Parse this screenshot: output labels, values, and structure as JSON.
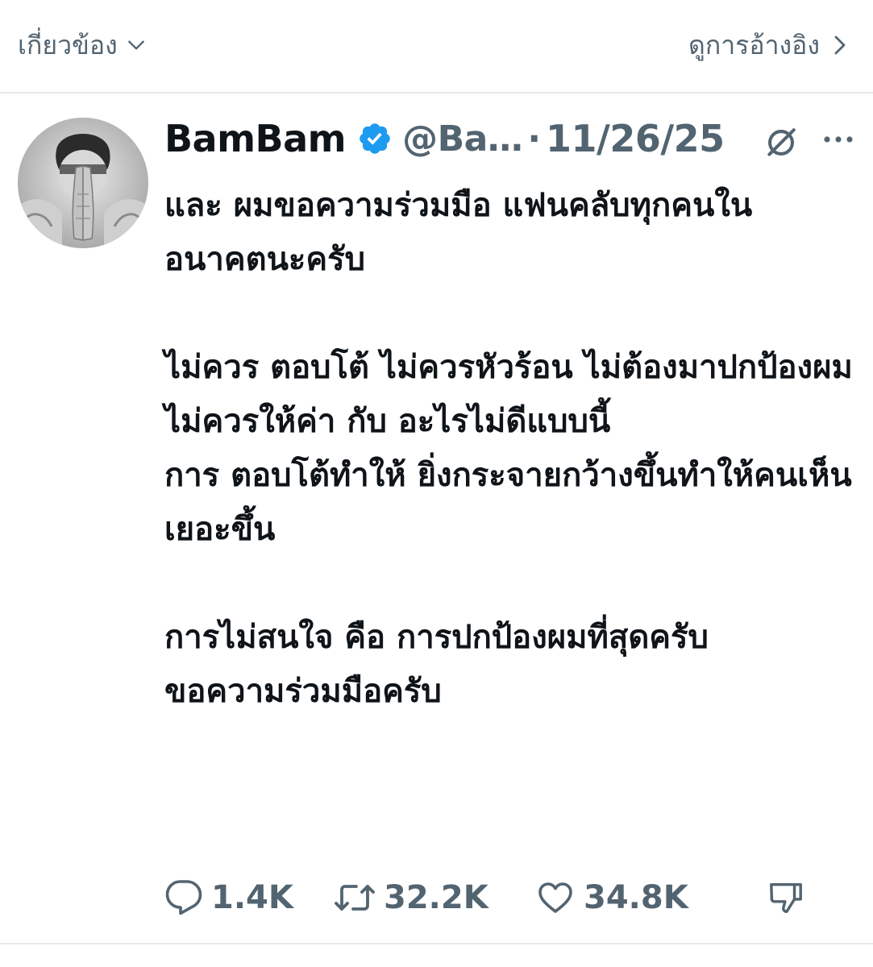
{
  "topbar": {
    "related_label": "เกี่ยวข้อง",
    "related_icon": "chevron-down-icon",
    "quotes_label": "ดูการอ้างอิง",
    "quotes_icon": "chevron-right-icon"
  },
  "tweet": {
    "display_name": "BamBam",
    "verified": true,
    "verified_color": "#1d9bf0",
    "handle": "@Ba…",
    "separator": "·",
    "date": "11/26/25",
    "header_icons": [
      "grok-icon",
      "more-icon"
    ],
    "text": "และ ผมขอความร่วมมือ แฟนคลับทุกคนใน อนาคตนะครับ\n\nไม่ควร ตอบโต้ ไม่ควรหัวร้อน ไม่ต้องมาปกป้องผม ไม่ควรให้ค่า กับ อะไรไม่ดีแบบนี้\nการ ตอบโต้ทำให้ ยิ่งกระจายกว้างขึ้นทำให้คนเห็นเยอะขึ้น\n\nการไม่สนใจ คือ การปกป้องผมที่สุดครับ\nขอความร่วมมือครับ"
  },
  "actions": {
    "replies": "1.4K",
    "reposts": "32.2K",
    "likes": "34.8K",
    "reply_icon": "reply-icon",
    "repost_icon": "repost-icon",
    "like_icon": "heart-icon",
    "dislike_icon": "thumbs-down-icon"
  },
  "colors": {
    "text": "#0f1419",
    "secondary": "#536471",
    "divider": "#e6e9eb",
    "verified": "#1d9bf0"
  }
}
